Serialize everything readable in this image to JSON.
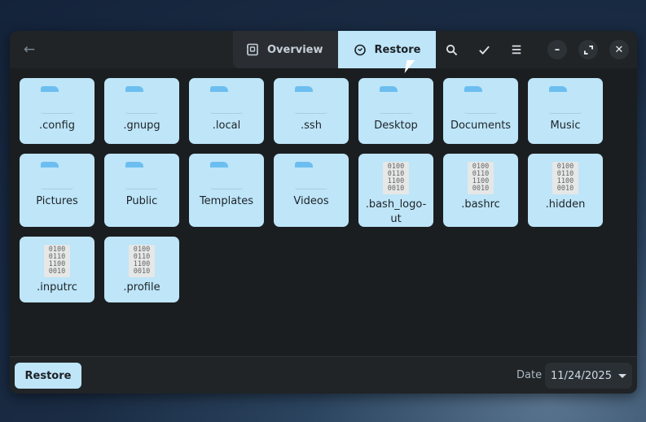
{
  "header": {
    "tabs": [
      {
        "label": "Overview",
        "icon": "overview-icon"
      },
      {
        "label": "Restore",
        "icon": "clock-icon",
        "active": true
      }
    ],
    "tools": [
      "search-icon",
      "check-icon",
      "menu-icon"
    ]
  },
  "files": [
    {
      "name": ".config",
      "type": "folder"
    },
    {
      "name": ".gnupg",
      "type": "folder"
    },
    {
      "name": ".local",
      "type": "folder"
    },
    {
      "name": ".ssh",
      "type": "folder"
    },
    {
      "name": "Desktop",
      "type": "folder"
    },
    {
      "name": "Documents",
      "type": "folder"
    },
    {
      "name": "Music",
      "type": "folder"
    },
    {
      "name": "Pictures",
      "type": "folder"
    },
    {
      "name": "Public",
      "type": "folder"
    },
    {
      "name": "Templates",
      "type": "folder"
    },
    {
      "name": "Videos",
      "type": "folder"
    },
    {
      "name": ".bash_logo-ut",
      "type": "file"
    },
    {
      "name": ".bashrc",
      "type": "file"
    },
    {
      "name": ".hidden",
      "type": "file"
    },
    {
      "name": ".inputrc",
      "type": "file"
    },
    {
      "name": ".profile",
      "type": "file"
    }
  ],
  "binary_glyph": [
    "0100",
    "0110",
    "1100",
    "0010"
  ],
  "footer": {
    "restore_label": "Restore",
    "date_label": "Date",
    "date_value": "11/24/2025"
  }
}
